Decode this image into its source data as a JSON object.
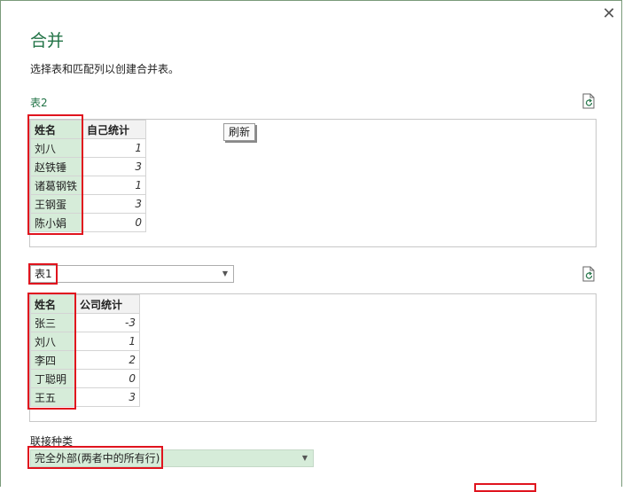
{
  "dialog": {
    "title": "合并",
    "subtitle": "选择表和匹配列以创建合并表。",
    "close_icon": "close-icon"
  },
  "table1": {
    "label": "表2",
    "tooltip": "刷新",
    "headers": [
      "姓名",
      "自己统计"
    ],
    "rows": [
      [
        "刘八",
        "1"
      ],
      [
        "赵铁锤",
        "3"
      ],
      [
        "诸葛钢铁",
        "1"
      ],
      [
        "王钢蛋",
        "3"
      ],
      [
        "陈小娟",
        "0"
      ]
    ]
  },
  "table2": {
    "selected": "表1",
    "headers": [
      "姓名",
      "公司统计"
    ],
    "rows": [
      [
        "张三",
        "-3"
      ],
      [
        "刘八",
        "1"
      ],
      [
        "李四",
        "2"
      ],
      [
        "丁聪明",
        "0"
      ],
      [
        "王五",
        "3"
      ]
    ]
  },
  "join": {
    "label": "联接种类",
    "selected": "完全外部(两者中的所有行)"
  },
  "colors": {
    "accent": "#217346",
    "highlight": "#d6ecd9",
    "annotation": "#e0141e"
  }
}
